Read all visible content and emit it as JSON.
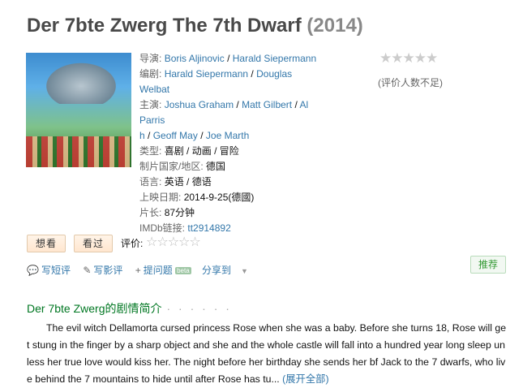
{
  "movie": {
    "title": "Der 7bte Zwerg The 7th Dwarf",
    "year": "(2014)"
  },
  "info": {
    "director_label": "导演:",
    "directors": [
      "Boris Aljinovic",
      "Harald Siepermann"
    ],
    "writer_label": "编剧:",
    "writers": [
      "Harald Siepermann",
      "Douglas Welbat"
    ],
    "cast_label": "主演:",
    "cast": [
      "Joshua Graham",
      "Matt Gilbert",
      "Al Parris",
      "h",
      "Geoff May",
      "Joe Marth"
    ],
    "genre_label": "类型:",
    "genres": [
      "喜剧",
      "动画",
      "冒险"
    ],
    "country_label": "制片国家/地区:",
    "country": "德国",
    "language_label": "语言:",
    "language": "英语 / 德语",
    "release_label": "上映日期:",
    "release": "2014-9-25(德國)",
    "runtime_label": "片长:",
    "runtime": "87分钟",
    "imdb_label": "IMDb链接:",
    "imdb": "tt2914892"
  },
  "rating": {
    "stars": "★★★★★",
    "note": "(评价人数不足)"
  },
  "buttons": {
    "want": "想看",
    "seen": "看过",
    "rate_label": "评价:",
    "rate_stars": "☆☆☆☆☆"
  },
  "actions": {
    "short_review": "写短评",
    "long_review": "写影评",
    "ask": "提问题",
    "beta": "beta",
    "share": "分享到",
    "recommend": "推荐"
  },
  "synopsis": {
    "title": "Der 7bte Zwerg的剧情简介",
    "dots": "· · · · · ·",
    "text": "The evil witch Dellamorta cursed princess Rose when she was a baby. Before she turns 18, Rose will get stung in the finger by a sharp object and she and the whole castle will fall into a hundred year long sleep unless her true love would kiss her. The night before her birthday she sends her bf Jack to the 7 dwarfs, who live behind the 7 mountains to hide until after Rose has tu...",
    "expand": "(展开全部)"
  }
}
